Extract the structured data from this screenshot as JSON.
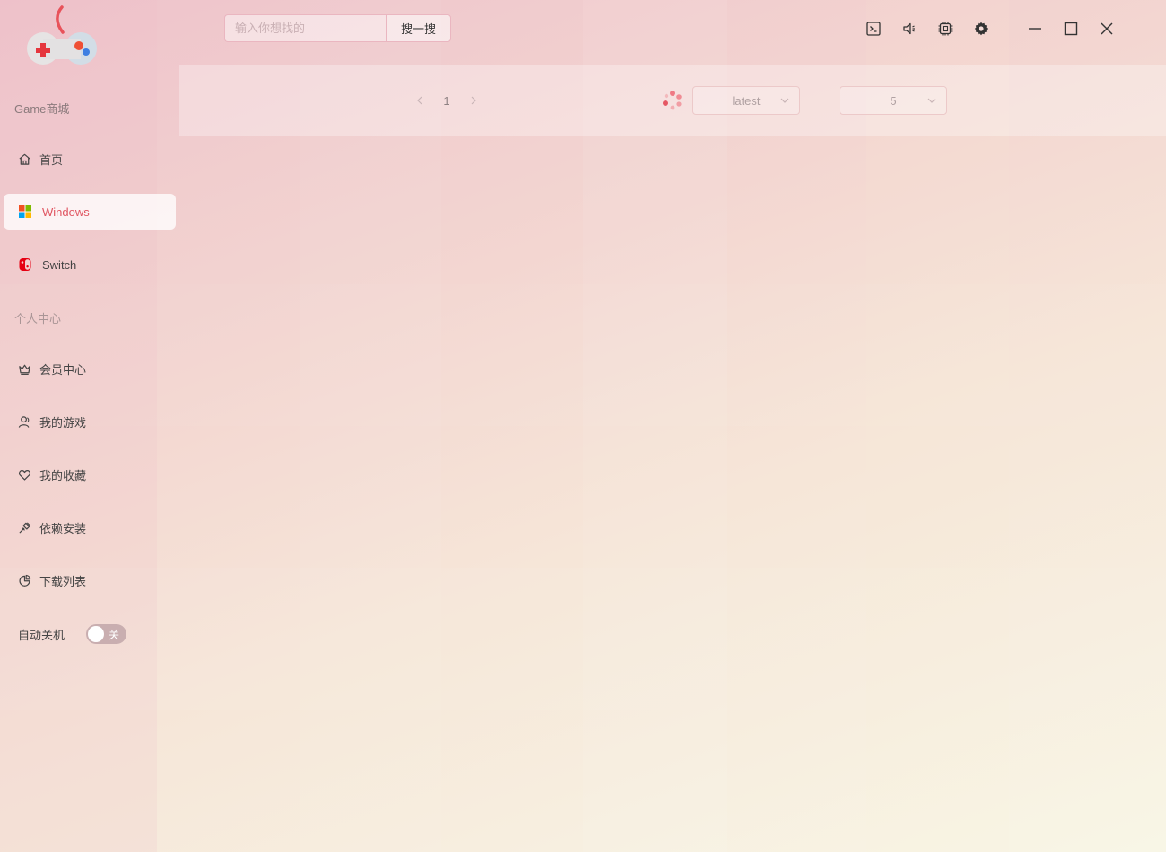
{
  "header": {
    "search_placeholder": "输入你想找的",
    "search_button": "搜一搜"
  },
  "titlebar_icons": [
    "terminal-icon",
    "volume-icon",
    "chip-icon",
    "settings-icon"
  ],
  "window_controls": [
    "minimize-icon",
    "maximize-icon",
    "close-icon"
  ],
  "sidebar": {
    "store_section": "Game商城",
    "store_items": [
      {
        "label": "首页",
        "icon": "home-icon"
      },
      {
        "label": "Windows",
        "icon": "windows-logo-icon",
        "active": true
      },
      {
        "label": "Switch",
        "icon": "switch-logo-icon"
      }
    ],
    "personal_section": "个人中心",
    "personal_items": [
      {
        "label": "会员中心",
        "icon": "crown-icon"
      },
      {
        "label": "我的游戏",
        "icon": "user-icon"
      },
      {
        "label": "我的收藏",
        "icon": "heart-icon"
      },
      {
        "label": "依赖安装",
        "icon": "plug-icon"
      },
      {
        "label": "下载列表",
        "icon": "pie-chart-icon"
      }
    ],
    "auto_shutdown": {
      "label": "自动关机",
      "state_text": "关",
      "on": false
    }
  },
  "toolbar": {
    "pagination": {
      "prev": "<",
      "current": "1",
      "next": ">"
    },
    "sort_select": "latest",
    "page_size_select": "5"
  },
  "colors": {
    "accent": "#e05561",
    "switch_off": "#c9aeb0"
  }
}
